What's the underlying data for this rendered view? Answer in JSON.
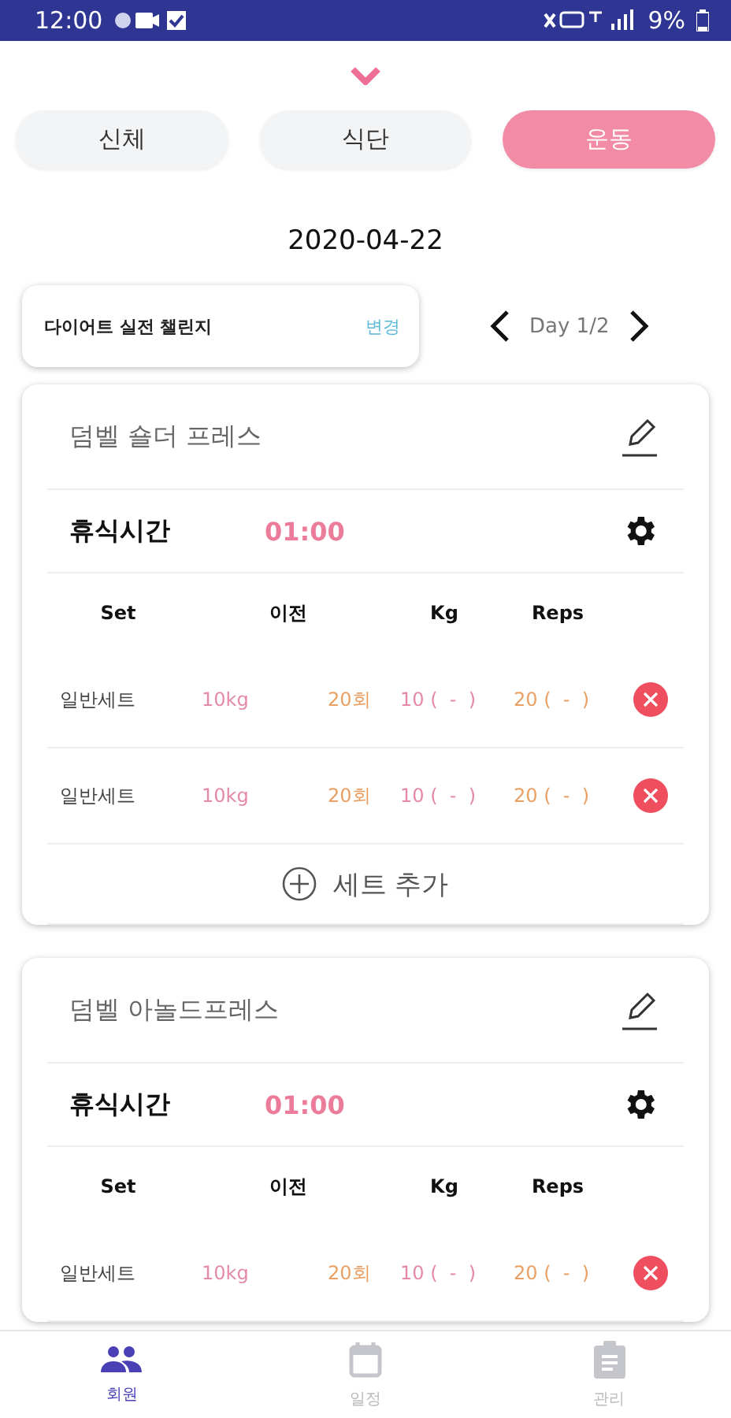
{
  "status_bar": {
    "time": "12:00",
    "battery": "9%"
  },
  "tabs": [
    {
      "label": "신체",
      "selected": false
    },
    {
      "label": "식단",
      "selected": false
    },
    {
      "label": "운동",
      "selected": true
    }
  ],
  "date": "2020-04-22",
  "challenge": {
    "title": "다이어트 실전 챌린지",
    "action": "변경"
  },
  "day_nav": {
    "label": "Day 1/2"
  },
  "exercises": [
    {
      "name": "덤벨 숄더 프레스",
      "rest_label": "휴식시간",
      "rest_time": "01:00",
      "columns": [
        "Set",
        "이전",
        "Kg",
        "Reps"
      ],
      "sets": [
        {
          "type": "일반세트",
          "prev_weight": "10kg",
          "prev_reps": "20회",
          "weight": "10 (  -  )",
          "reps": "20 (  -  )"
        },
        {
          "type": "일반세트",
          "prev_weight": "10kg",
          "prev_reps": "20회",
          "weight": "10 (  -  )",
          "reps": "20 (  -  )"
        }
      ],
      "add_set": "세트 추가"
    },
    {
      "name": "덤벨 아놀드프레스",
      "rest_label": "휴식시간",
      "rest_time": "01:00",
      "columns": [
        "Set",
        "이전",
        "Kg",
        "Reps"
      ],
      "sets": [
        {
          "type": "일반세트",
          "prev_weight": "10kg",
          "prev_reps": "20회",
          "weight": "10 (  -  )",
          "reps": "20 (  -  )"
        }
      ]
    }
  ],
  "nav": [
    {
      "label": "회원",
      "selected": true
    },
    {
      "label": "일정",
      "selected": false
    },
    {
      "label": "관리",
      "selected": false
    }
  ]
}
